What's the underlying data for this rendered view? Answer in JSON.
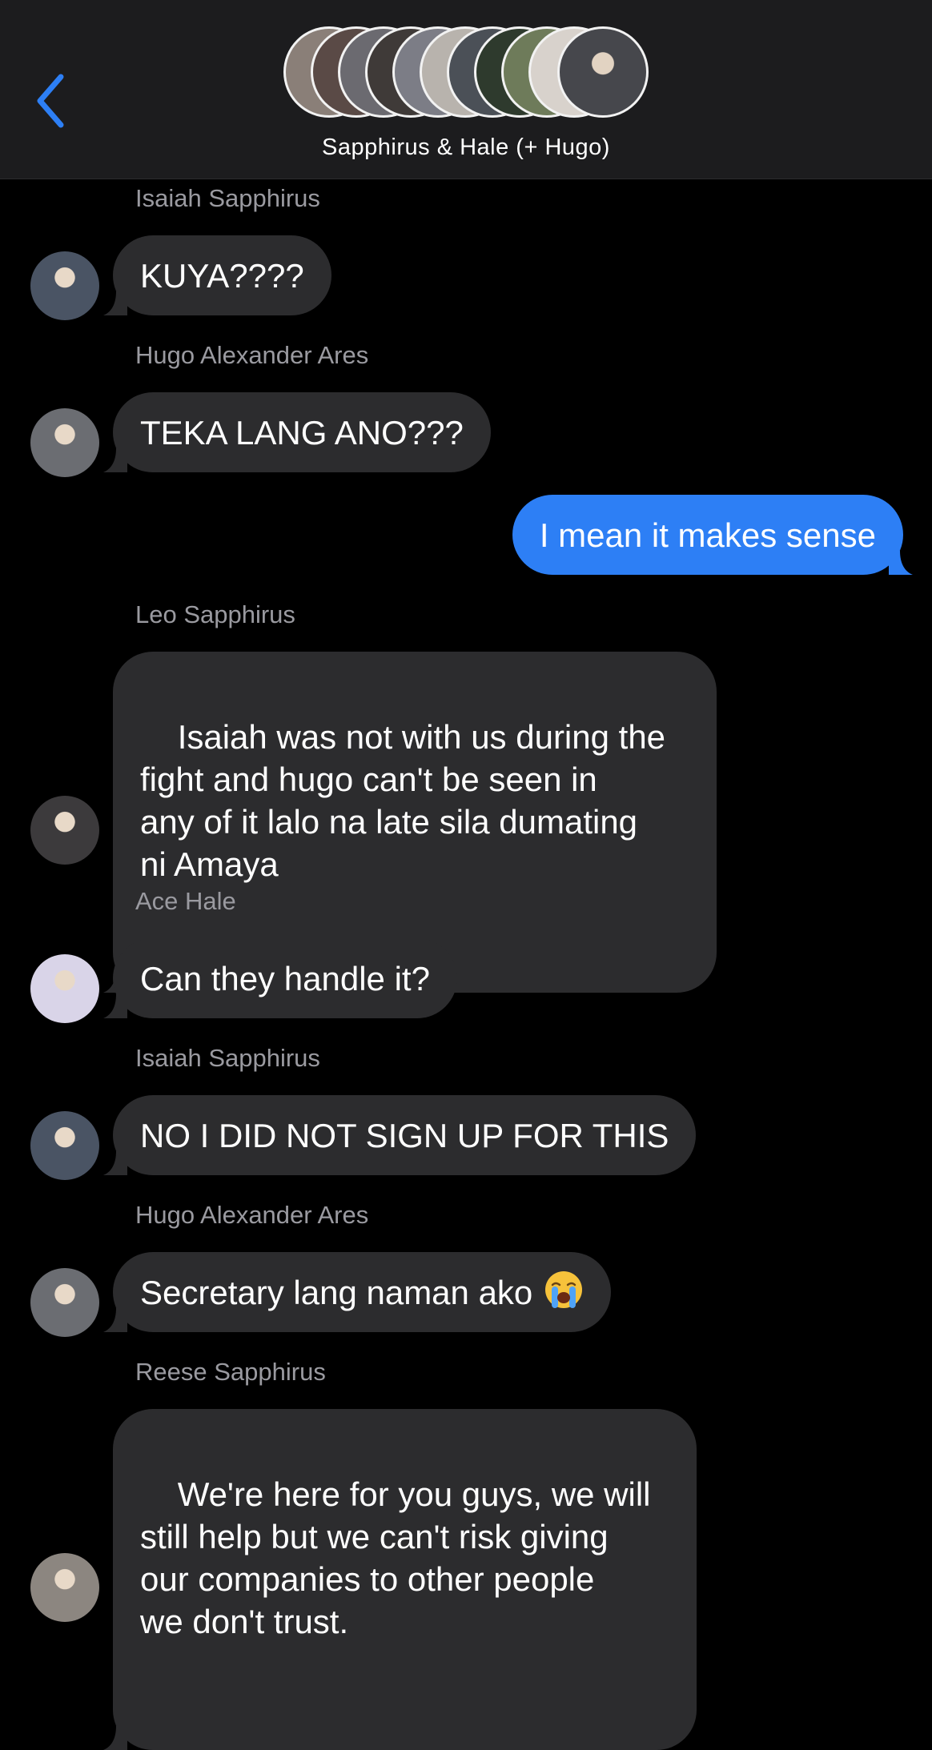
{
  "header": {
    "chat_title": "Sapphirus & Hale (+ Hugo)",
    "back_icon": "chevron-left-icon",
    "accent_color": "#2d7ff5",
    "stack_colors": [
      "#8a7f78",
      "#5a4a46",
      "#6b6a70",
      "#3f3a38",
      "#7c7d86",
      "#b8b3ad",
      "#4b5057",
      "#2e3a2d",
      "#6e7b5a",
      "#d8d2cc",
      "#46474c"
    ]
  },
  "messages": [
    {
      "sender": "Isaiah Sapphirus",
      "text": "KUYA????",
      "avatar_color": "#4a5464"
    },
    {
      "sender": "Hugo Alexander Ares",
      "text": "TEKA LANG ANO???",
      "avatar_color": "#6b6d72"
    },
    {
      "text": "I mean it makes sense",
      "outgoing": true
    },
    {
      "sender": "Leo Sapphirus",
      "text": "Isaiah was not with us during the\nfight and hugo can't be seen in\nany of it lalo na late sila dumating\nni Amaya",
      "avatar_color": "#3c3a3c"
    },
    {
      "sender": "Ace Hale",
      "text": "Can they handle it?",
      "avatar_color": "#d9d4e8"
    },
    {
      "sender": "Isaiah Sapphirus",
      "text": "NO I DID NOT SIGN UP FOR THIS",
      "avatar_color": "#4a5464"
    },
    {
      "sender": "Hugo Alexander Ares",
      "text": "Secretary lang naman ako",
      "emoji": "loudly-crying-face",
      "avatar_color": "#6b6d72"
    },
    {
      "sender": "Reese Sapphirus",
      "text": "We're here for you guys, we will\nstill help but we can't risk giving\nour companies to other people\nwe don't trust.",
      "avatar_color": "#8c8680"
    }
  ]
}
